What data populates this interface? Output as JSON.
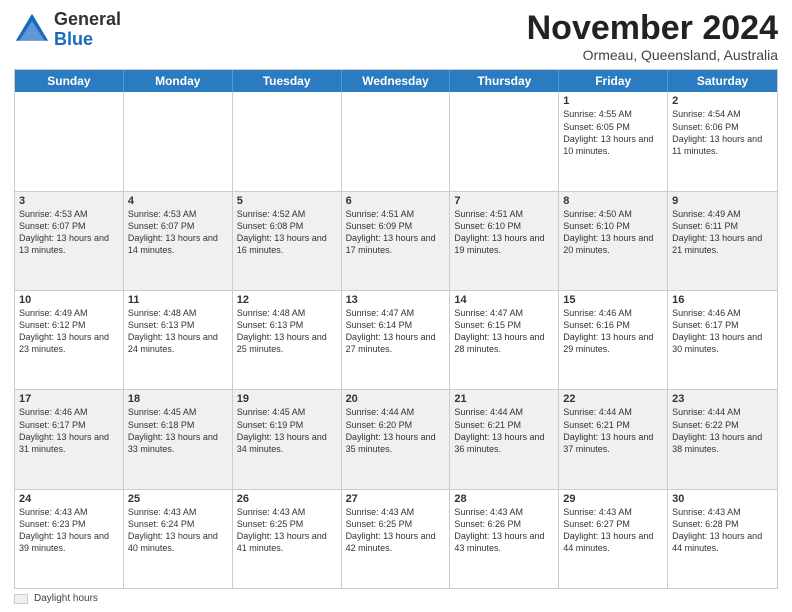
{
  "header": {
    "logo_general": "General",
    "logo_blue": "Blue",
    "month_title": "November 2024",
    "location": "Ormeau, Queensland, Australia"
  },
  "calendar": {
    "days_of_week": [
      "Sunday",
      "Monday",
      "Tuesday",
      "Wednesday",
      "Thursday",
      "Friday",
      "Saturday"
    ],
    "weeks": [
      [
        {
          "day": "",
          "info": ""
        },
        {
          "day": "",
          "info": ""
        },
        {
          "day": "",
          "info": ""
        },
        {
          "day": "",
          "info": ""
        },
        {
          "day": "",
          "info": ""
        },
        {
          "day": "1",
          "info": "Sunrise: 4:55 AM\nSunset: 6:05 PM\nDaylight: 13 hours and 10 minutes."
        },
        {
          "day": "2",
          "info": "Sunrise: 4:54 AM\nSunset: 6:06 PM\nDaylight: 13 hours and 11 minutes."
        }
      ],
      [
        {
          "day": "3",
          "info": "Sunrise: 4:53 AM\nSunset: 6:07 PM\nDaylight: 13 hours and 13 minutes."
        },
        {
          "day": "4",
          "info": "Sunrise: 4:53 AM\nSunset: 6:07 PM\nDaylight: 13 hours and 14 minutes."
        },
        {
          "day": "5",
          "info": "Sunrise: 4:52 AM\nSunset: 6:08 PM\nDaylight: 13 hours and 16 minutes."
        },
        {
          "day": "6",
          "info": "Sunrise: 4:51 AM\nSunset: 6:09 PM\nDaylight: 13 hours and 17 minutes."
        },
        {
          "day": "7",
          "info": "Sunrise: 4:51 AM\nSunset: 6:10 PM\nDaylight: 13 hours and 19 minutes."
        },
        {
          "day": "8",
          "info": "Sunrise: 4:50 AM\nSunset: 6:10 PM\nDaylight: 13 hours and 20 minutes."
        },
        {
          "day": "9",
          "info": "Sunrise: 4:49 AM\nSunset: 6:11 PM\nDaylight: 13 hours and 21 minutes."
        }
      ],
      [
        {
          "day": "10",
          "info": "Sunrise: 4:49 AM\nSunset: 6:12 PM\nDaylight: 13 hours and 23 minutes."
        },
        {
          "day": "11",
          "info": "Sunrise: 4:48 AM\nSunset: 6:13 PM\nDaylight: 13 hours and 24 minutes."
        },
        {
          "day": "12",
          "info": "Sunrise: 4:48 AM\nSunset: 6:13 PM\nDaylight: 13 hours and 25 minutes."
        },
        {
          "day": "13",
          "info": "Sunrise: 4:47 AM\nSunset: 6:14 PM\nDaylight: 13 hours and 27 minutes."
        },
        {
          "day": "14",
          "info": "Sunrise: 4:47 AM\nSunset: 6:15 PM\nDaylight: 13 hours and 28 minutes."
        },
        {
          "day": "15",
          "info": "Sunrise: 4:46 AM\nSunset: 6:16 PM\nDaylight: 13 hours and 29 minutes."
        },
        {
          "day": "16",
          "info": "Sunrise: 4:46 AM\nSunset: 6:17 PM\nDaylight: 13 hours and 30 minutes."
        }
      ],
      [
        {
          "day": "17",
          "info": "Sunrise: 4:46 AM\nSunset: 6:17 PM\nDaylight: 13 hours and 31 minutes."
        },
        {
          "day": "18",
          "info": "Sunrise: 4:45 AM\nSunset: 6:18 PM\nDaylight: 13 hours and 33 minutes."
        },
        {
          "day": "19",
          "info": "Sunrise: 4:45 AM\nSunset: 6:19 PM\nDaylight: 13 hours and 34 minutes."
        },
        {
          "day": "20",
          "info": "Sunrise: 4:44 AM\nSunset: 6:20 PM\nDaylight: 13 hours and 35 minutes."
        },
        {
          "day": "21",
          "info": "Sunrise: 4:44 AM\nSunset: 6:21 PM\nDaylight: 13 hours and 36 minutes."
        },
        {
          "day": "22",
          "info": "Sunrise: 4:44 AM\nSunset: 6:21 PM\nDaylight: 13 hours and 37 minutes."
        },
        {
          "day": "23",
          "info": "Sunrise: 4:44 AM\nSunset: 6:22 PM\nDaylight: 13 hours and 38 minutes."
        }
      ],
      [
        {
          "day": "24",
          "info": "Sunrise: 4:43 AM\nSunset: 6:23 PM\nDaylight: 13 hours and 39 minutes."
        },
        {
          "day": "25",
          "info": "Sunrise: 4:43 AM\nSunset: 6:24 PM\nDaylight: 13 hours and 40 minutes."
        },
        {
          "day": "26",
          "info": "Sunrise: 4:43 AM\nSunset: 6:25 PM\nDaylight: 13 hours and 41 minutes."
        },
        {
          "day": "27",
          "info": "Sunrise: 4:43 AM\nSunset: 6:25 PM\nDaylight: 13 hours and 42 minutes."
        },
        {
          "day": "28",
          "info": "Sunrise: 4:43 AM\nSunset: 6:26 PM\nDaylight: 13 hours and 43 minutes."
        },
        {
          "day": "29",
          "info": "Sunrise: 4:43 AM\nSunset: 6:27 PM\nDaylight: 13 hours and 44 minutes."
        },
        {
          "day": "30",
          "info": "Sunrise: 4:43 AM\nSunset: 6:28 PM\nDaylight: 13 hours and 44 minutes."
        }
      ]
    ]
  },
  "footer": {
    "legend_label": "Daylight hours"
  }
}
